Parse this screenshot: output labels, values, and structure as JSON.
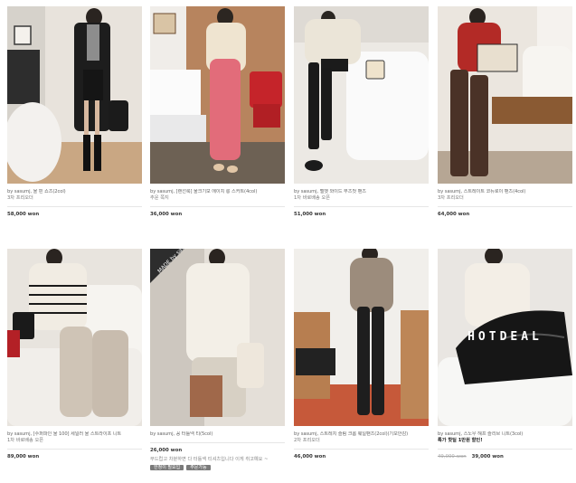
{
  "products": [
    {
      "title": "by sasumj, 울 핀 쇼츠(2col)",
      "sub": "3차 프리오더",
      "price": "58,000 won"
    },
    {
      "title": "by sasumj, [랜선룩] 울크기모 에이치 롱 스커트(4col)",
      "sub": "추운 쪽지",
      "price": "36,000 won"
    },
    {
      "title": "by sasumj, 벨벳 와이드 부츠컷 팬츠",
      "sub": "1차 바로배송 오픈",
      "price": "51,000 won"
    },
    {
      "title": "by sasumj, 스트레이트 코듀로이 팬츠(4col)",
      "sub": "3차 프리오더",
      "price": "64,000 won"
    },
    {
      "title": "by sasumj, [수퍼파인 울 100] 세일러 울 스트라이프 니트",
      "sub": "1차 바로배송 오픈",
      "price": "89,000 won"
    },
    {
      "title": "by sasumj, 꽁 터틀넥 티(5col)",
      "sub": "",
      "price": "26,000 won",
      "desc": "부드럽고 차분하면 다 터틀넥 티셔츠입니다 이게 취고예요 ~",
      "badges": [
        "한정이 필요입",
        "주문가능"
      ],
      "ribbon": "MADE by sasumj"
    },
    {
      "title": "by sasumj, 스트레치 슬림 크롬 웨일팬츠(2col)(기모안감)",
      "sub": "2차 프리오더",
      "price": "46,000 won"
    },
    {
      "title": "by sasumj, 스노우 해프 슬리브 니트(3col)",
      "sub": "특가 핫딜 1만원 할인!",
      "price": "39,000 won",
      "old_price": "49,000 won",
      "overlay": "HOTDEAL"
    }
  ]
}
